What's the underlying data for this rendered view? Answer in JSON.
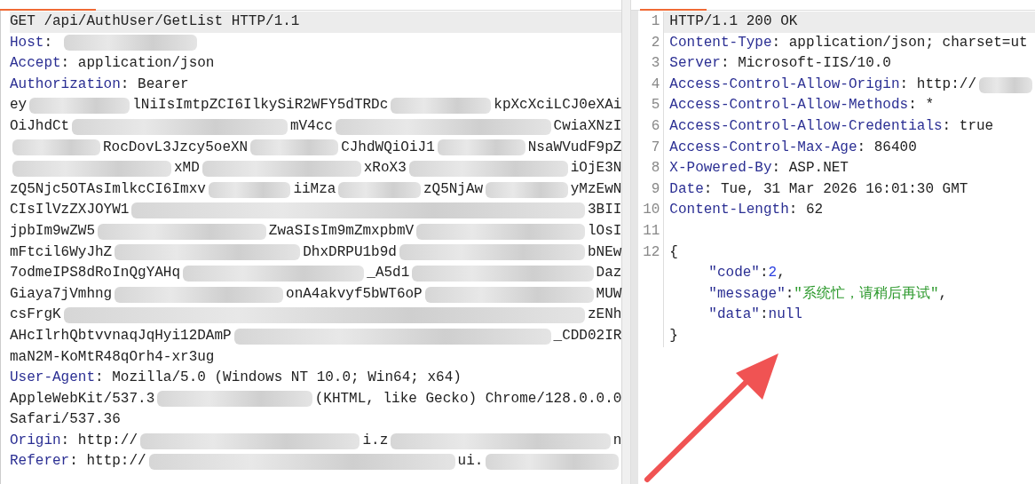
{
  "request": {
    "lines": [
      {
        "highlighted": true,
        "segments": [
          {
            "kind": "text",
            "text": "GET /api/AuthUser/GetList HTTP/1.1"
          }
        ]
      },
      {
        "highlighted": false,
        "segments": [
          {
            "kind": "key",
            "text": "Host"
          },
          {
            "kind": "text",
            "text": ": "
          },
          {
            "kind": "redacted"
          }
        ]
      },
      {
        "highlighted": false,
        "segments": [
          {
            "kind": "key",
            "text": "Accept"
          },
          {
            "kind": "text",
            "text": ": application/json"
          }
        ]
      },
      {
        "highlighted": false,
        "segments": [
          {
            "kind": "key",
            "text": "Authorization"
          },
          {
            "kind": "text",
            "text": ": Bearer"
          }
        ]
      },
      {
        "highlighted": false,
        "segments": [
          {
            "kind": "text",
            "text": "ey"
          },
          {
            "kind": "redacted"
          },
          {
            "kind": "text",
            "text": "lNiIsImtpZCI6IlkySiR2WFY5dTRDc"
          },
          {
            "kind": "redacted"
          },
          {
            "kind": "text",
            "text": "kpXcXciLCJ0eXAi"
          }
        ]
      },
      {
        "highlighted": false,
        "segments": [
          {
            "kind": "text",
            "text": "OiJhdCt"
          },
          {
            "kind": "redacted"
          },
          {
            "kind": "text",
            "text": "mV4cc"
          },
          {
            "kind": "redacted"
          },
          {
            "kind": "text",
            "text": "CwiaXNzI"
          }
        ]
      },
      {
        "highlighted": false,
        "segments": [
          {
            "kind": "redacted"
          },
          {
            "kind": "text",
            "text": "RocDovL3Jzcy5oeXN"
          },
          {
            "kind": "redacted"
          },
          {
            "kind": "text",
            "text": "CJhdWQiOiJ1"
          },
          {
            "kind": "redacted"
          },
          {
            "kind": "text",
            "text": "NsaWVudF9pZ"
          }
        ]
      },
      {
        "highlighted": false,
        "segments": [
          {
            "kind": "redacted"
          },
          {
            "kind": "text",
            "text": "xMD"
          },
          {
            "kind": "redacted"
          },
          {
            "kind": "text",
            "text": "xRoX3"
          },
          {
            "kind": "redacted"
          },
          {
            "kind": "text",
            "text": "iOjE3N"
          }
        ]
      },
      {
        "highlighted": false,
        "segments": [
          {
            "kind": "text",
            "text": "zQ5Njc5OTAsImlkcCI6Imxv"
          },
          {
            "kind": "redacted"
          },
          {
            "kind": "text",
            "text": "iiMza"
          },
          {
            "kind": "redacted"
          },
          {
            "kind": "text",
            "text": "zQ5NjAw"
          },
          {
            "kind": "redacted"
          },
          {
            "kind": "text",
            "text": "yMzEwN"
          }
        ]
      },
      {
        "highlighted": false,
        "segments": [
          {
            "kind": "text",
            "text": "CIsIlVzZXJOYW1"
          },
          {
            "kind": "redacted"
          },
          {
            "kind": "text",
            "text": "3BII"
          }
        ]
      },
      {
        "highlighted": false,
        "segments": [
          {
            "kind": "text",
            "text": "jpbIm9wZW5"
          },
          {
            "kind": "redacted"
          },
          {
            "kind": "text",
            "text": "ZwaSIsIm9mZmxpbmV"
          },
          {
            "kind": "redacted"
          },
          {
            "kind": "text",
            "text": "lOsI"
          }
        ]
      },
      {
        "highlighted": false,
        "segments": [
          {
            "kind": "text",
            "text": "mFtcil6WyJhZ"
          },
          {
            "kind": "redacted"
          },
          {
            "kind": "text",
            "text": "DhxDRPU1b9d"
          },
          {
            "kind": "redacted"
          },
          {
            "kind": "text",
            "text": "bNEw"
          }
        ]
      },
      {
        "highlighted": false,
        "segments": [
          {
            "kind": "text",
            "text": "7odmeIPS8dRoInQgYAHq"
          },
          {
            "kind": "redacted"
          },
          {
            "kind": "text",
            "text": "_A5d1"
          },
          {
            "kind": "redacted"
          },
          {
            "kind": "text",
            "text": "Daz"
          }
        ]
      },
      {
        "highlighted": false,
        "segments": [
          {
            "kind": "text",
            "text": "Giaya7jVmhng"
          },
          {
            "kind": "redacted"
          },
          {
            "kind": "text",
            "text": "onA4akvyf5bWT6oP"
          },
          {
            "kind": "redacted"
          },
          {
            "kind": "text",
            "text": "MUW"
          }
        ]
      },
      {
        "highlighted": false,
        "segments": [
          {
            "kind": "text",
            "text": "csFrgK"
          },
          {
            "kind": "redacted"
          },
          {
            "kind": "text",
            "text": "zENh"
          }
        ]
      },
      {
        "highlighted": false,
        "segments": [
          {
            "kind": "text",
            "text": "AHcIlrhQbtvvnaqJqHyi12DAmP"
          },
          {
            "kind": "redacted"
          },
          {
            "kind": "text",
            "text": "_CDD02IR"
          }
        ]
      },
      {
        "highlighted": false,
        "segments": [
          {
            "kind": "text",
            "text": "maN2M-KoMtR48qOrh4-xr3ug"
          }
        ]
      },
      {
        "highlighted": false,
        "segments": [
          {
            "kind": "key",
            "text": "User-Agent"
          },
          {
            "kind": "text",
            "text": ": Mozilla/5.0 (Windows NT 10.0; Win64; x64)"
          }
        ]
      },
      {
        "highlighted": false,
        "segments": [
          {
            "kind": "text",
            "text": "AppleWebKit/537.3"
          },
          {
            "kind": "redacted"
          },
          {
            "kind": "text",
            "text": "(KHTML, like Gecko) Chrome/128.0.0.0"
          }
        ]
      },
      {
        "highlighted": false,
        "segments": [
          {
            "kind": "text",
            "text": "Safari/537.36"
          }
        ]
      },
      {
        "highlighted": false,
        "segments": [
          {
            "kind": "key",
            "text": "Origin"
          },
          {
            "kind": "text",
            "text": ": http://"
          },
          {
            "kind": "redacted"
          },
          {
            "kind": "text",
            "text": "i.z"
          },
          {
            "kind": "redacted"
          },
          {
            "kind": "text",
            "text": "n"
          }
        ]
      },
      {
        "highlighted": false,
        "segments": [
          {
            "kind": "key",
            "text": "Referer"
          },
          {
            "kind": "text",
            "text": ": http://"
          },
          {
            "kind": "redacted"
          },
          {
            "kind": "text",
            "text": "ui."
          },
          {
            "kind": "redacted"
          }
        ]
      }
    ]
  },
  "response": {
    "lines": [
      {
        "number": "1",
        "highlighted": true,
        "segments": [
          {
            "kind": "text",
            "text": "HTTP/1.1 200 OK"
          }
        ]
      },
      {
        "number": "2",
        "highlighted": false,
        "segments": [
          {
            "kind": "key",
            "text": "Content-Type"
          },
          {
            "kind": "text",
            "text": ": application/json; charset=ut"
          }
        ]
      },
      {
        "number": "3",
        "highlighted": false,
        "segments": [
          {
            "kind": "key",
            "text": "Server"
          },
          {
            "kind": "text",
            "text": ": Microsoft-IIS/10.0"
          }
        ]
      },
      {
        "number": "4",
        "highlighted": false,
        "segments": [
          {
            "kind": "key",
            "text": "Access-Control-Allow-Origin"
          },
          {
            "kind": "text",
            "text": ": http://"
          },
          {
            "kind": "redacted"
          }
        ]
      },
      {
        "number": "5",
        "highlighted": false,
        "segments": [
          {
            "kind": "key",
            "text": "Access-Control-Allow-Methods"
          },
          {
            "kind": "text",
            "text": ": *"
          }
        ]
      },
      {
        "number": "6",
        "highlighted": false,
        "segments": [
          {
            "kind": "key",
            "text": "Access-Control-Allow-Credentials"
          },
          {
            "kind": "text",
            "text": ": true"
          }
        ]
      },
      {
        "number": "7",
        "highlighted": false,
        "segments": [
          {
            "kind": "key",
            "text": "Access-Control-Max-Age"
          },
          {
            "kind": "text",
            "text": ": 86400"
          }
        ]
      },
      {
        "number": "8",
        "highlighted": false,
        "segments": [
          {
            "kind": "key",
            "text": "X-Powered-By"
          },
          {
            "kind": "text",
            "text": ": ASP.NET"
          }
        ]
      },
      {
        "number": "9",
        "highlighted": false,
        "segments": [
          {
            "kind": "key",
            "text": "Date"
          },
          {
            "kind": "text",
            "text": ": Tue, 31 Mar 2026 16:01:30 GMT"
          }
        ]
      },
      {
        "number": "10",
        "highlighted": false,
        "segments": [
          {
            "kind": "key",
            "text": "Content-Length"
          },
          {
            "kind": "text",
            "text": ": 62"
          }
        ]
      },
      {
        "number": "11",
        "highlighted": false
      },
      {
        "number": "12",
        "highlighted": false,
        "segments": [
          {
            "kind": "text",
            "text": "{"
          }
        ]
      },
      {
        "highlighted": false,
        "indented": true,
        "segments": [
          {
            "kind": "jkey",
            "text": "\"code\""
          },
          {
            "kind": "text",
            "text": ":"
          },
          {
            "kind": "jnum",
            "text": "2"
          },
          {
            "kind": "text",
            "text": ","
          }
        ]
      },
      {
        "highlighted": false,
        "indented": true,
        "segments": [
          {
            "kind": "jkey",
            "text": "\"message\""
          },
          {
            "kind": "text",
            "text": ":"
          },
          {
            "kind": "jstr",
            "text": "\"系统忙，请稍后再试\""
          },
          {
            "kind": "text",
            "text": ","
          }
        ]
      },
      {
        "highlighted": false,
        "indented": true,
        "segments": [
          {
            "kind": "jkey",
            "text": "\"data\""
          },
          {
            "kind": "text",
            "text": ":"
          },
          {
            "kind": "jnull",
            "text": "null"
          }
        ]
      },
      {
        "highlighted": false,
        "segments": [
          {
            "kind": "text",
            "text": "}"
          }
        ]
      }
    ]
  }
}
